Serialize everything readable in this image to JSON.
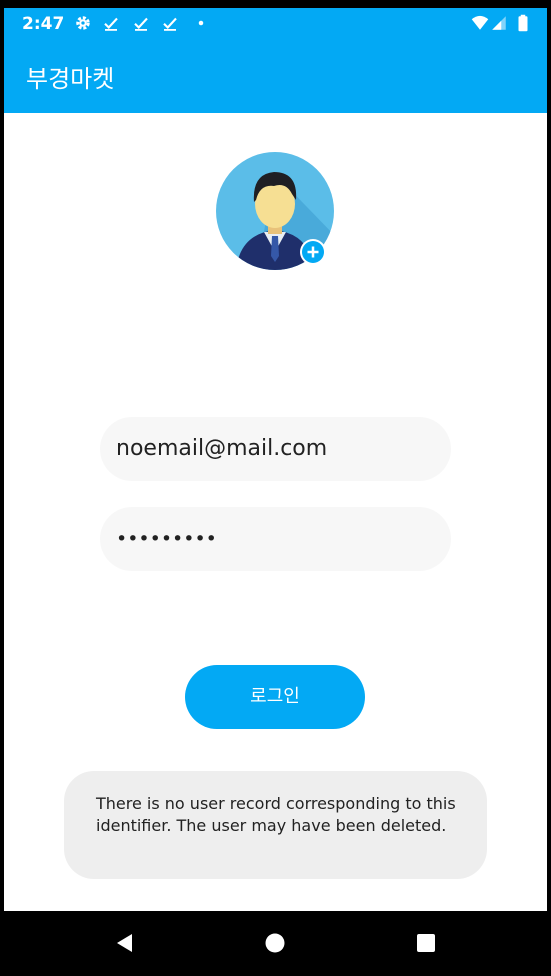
{
  "status_bar": {
    "time": "2:47",
    "icons": [
      "settings-icon",
      "download-done-icon",
      "download-done-icon",
      "download-done-icon",
      "dot-icon",
      "wifi-icon",
      "signal-icon",
      "battery-icon"
    ]
  },
  "app_bar": {
    "title": "부경마켓"
  },
  "colors": {
    "primary": "#03a9f4",
    "field_bg": "#f7f7f7",
    "toast_bg": "#eeeeee"
  },
  "login_form": {
    "email_value": "noemail@mail.com",
    "password_value": "•••••••••",
    "login_button_label": "로그인"
  },
  "toast": {
    "message": "There is no user record corresponding to this identifier. The user may have been deleted."
  },
  "nav_bar": {
    "icons": [
      "back-icon",
      "home-icon",
      "recents-icon"
    ]
  }
}
